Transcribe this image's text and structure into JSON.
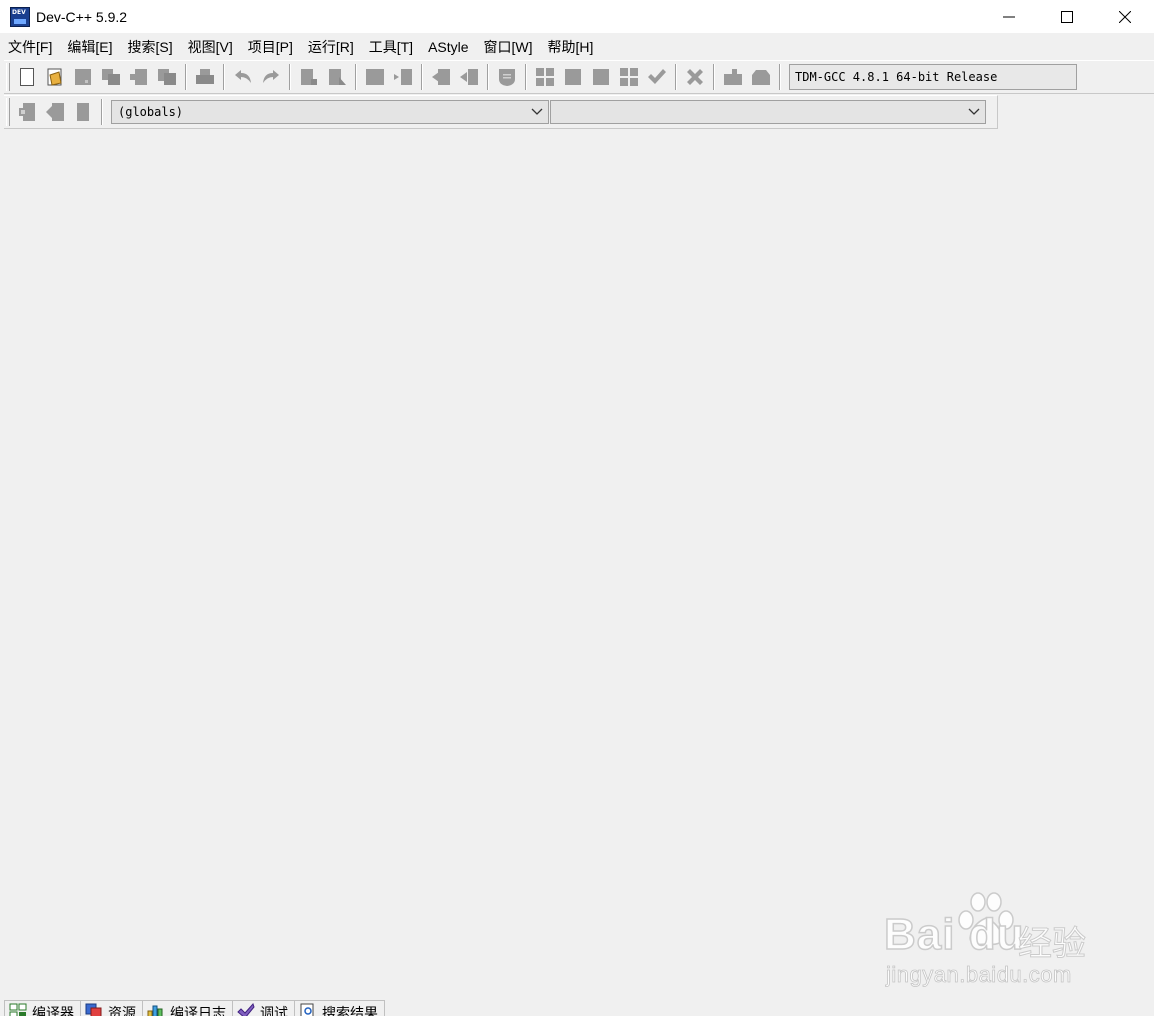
{
  "window": {
    "title": "Dev-C++ 5.9.2",
    "app_icon": "devcpp-icon",
    "controls": [
      "minimize-icon",
      "maximize-icon",
      "close-icon"
    ]
  },
  "menu": [
    {
      "label": "文件[F]"
    },
    {
      "label": "编辑[E]"
    },
    {
      "label": "搜索[S]"
    },
    {
      "label": "视图[V]"
    },
    {
      "label": "项目[P]"
    },
    {
      "label": "运行[R]"
    },
    {
      "label": "工具[T]"
    },
    {
      "label": "AStyle"
    },
    {
      "label": "窗口[W]"
    },
    {
      "label": "帮助[H]"
    }
  ],
  "toolbar": {
    "compiler": "TDM-GCC 4.8.1 64-bit Release"
  },
  "class_bar": {
    "scope_combo": "(globals)",
    "member_combo": ""
  },
  "bottom_tabs": [
    {
      "label": "编译器",
      "icon": "compiler-grid-icon"
    },
    {
      "label": "资源",
      "icon": "resources-icon"
    },
    {
      "label": "编译日志",
      "icon": "compile-log-chart-icon"
    },
    {
      "label": "调试",
      "icon": "debug-check-icon"
    },
    {
      "label": "搜索结果",
      "icon": "search-results-icon"
    }
  ],
  "watermark": {
    "logo": "Bai du",
    "suffix": "经验",
    "url": "jingyan.baidu.com"
  }
}
